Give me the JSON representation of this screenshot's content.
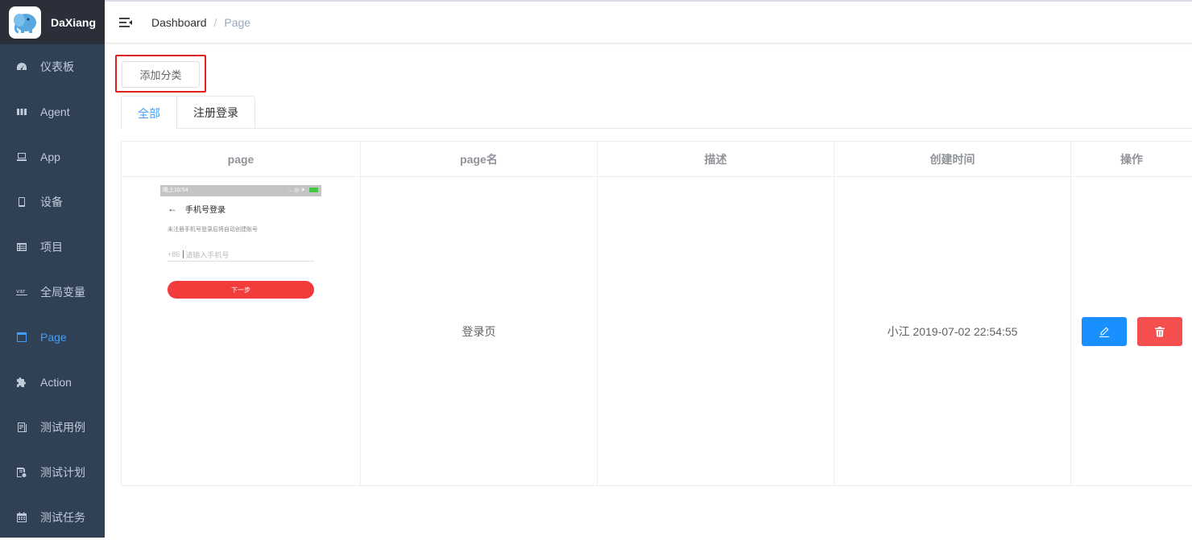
{
  "app": {
    "title": "DaXiang"
  },
  "sidebar": {
    "items": [
      {
        "label": "仪表板",
        "icon": "dashboard-icon",
        "active": false
      },
      {
        "label": "Agent",
        "icon": "agent-icon",
        "active": false
      },
      {
        "label": "App",
        "icon": "app-icon",
        "active": false
      },
      {
        "label": "设备",
        "icon": "phone-icon",
        "active": false
      },
      {
        "label": "项目",
        "icon": "list-icon",
        "active": false
      },
      {
        "label": "全局变量",
        "icon": "var-icon",
        "active": false
      },
      {
        "label": "Page",
        "icon": "page-icon",
        "active": true
      },
      {
        "label": "Action",
        "icon": "puzzle-icon",
        "active": false
      },
      {
        "label": "测试用例",
        "icon": "testcase-icon",
        "active": false
      },
      {
        "label": "测试计划",
        "icon": "testplan-icon",
        "active": false
      },
      {
        "label": "测试任务",
        "icon": "calendar-icon",
        "active": false
      }
    ]
  },
  "breadcrumb": {
    "root": "Dashboard",
    "separator": "/",
    "current": "Page"
  },
  "toolbar": {
    "add_category_label": "添加分类"
  },
  "tabs": [
    {
      "label": "全部",
      "active": true
    },
    {
      "label": "注册登录",
      "active": false
    }
  ],
  "table": {
    "headers": [
      "page",
      "page名",
      "描述",
      "创建时间",
      "操作"
    ],
    "rows": [
      {
        "screenshot": {
          "status_time": "晚上10:54",
          "status_right": "... ◎ ✈",
          "title": "手机号登录",
          "hint": "未注册手机号登录后将自动创建账号",
          "prefix": "+86",
          "placeholder": "请输入手机号",
          "next_label": "下一步"
        },
        "name": "登录页",
        "description": "",
        "created": "小江 2019-07-02 22:54:55"
      }
    ]
  },
  "colors": {
    "sidebar_bg": "#304156",
    "active": "#409eff",
    "edit": "#1890ff",
    "delete": "#f44e4e",
    "highlight_box": "#e02020"
  }
}
